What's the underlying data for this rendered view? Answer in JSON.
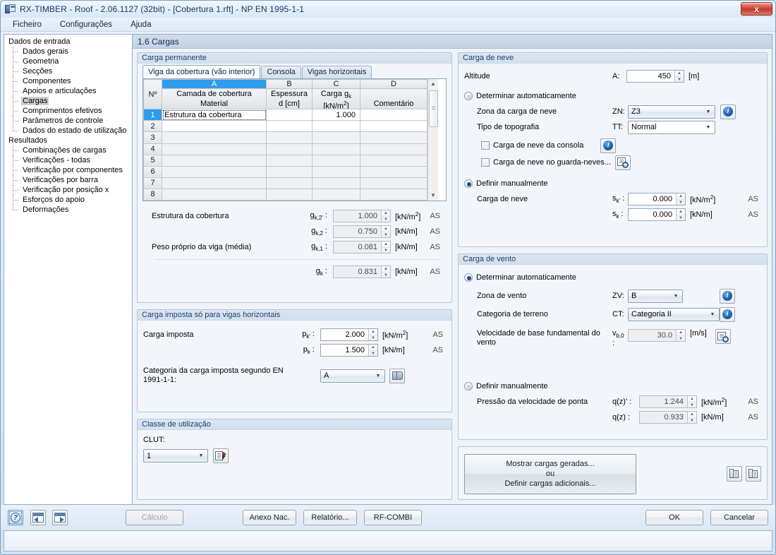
{
  "window": {
    "title": "RX-TIMBER - Roof - 2.06.1127 (32bit) - [Cobertura 1.rft] - NP EN 1995-1-1",
    "close_label": "x"
  },
  "menu": {
    "items": [
      "Ficheiro",
      "Configurações",
      "Ajuda"
    ]
  },
  "tree": {
    "groups": [
      {
        "label": "Dados de entrada",
        "items": [
          "Dados gerais",
          "Geometria",
          "Secções",
          "Componentes",
          "Apoios e articulações",
          "Cargas",
          "Comprimentos efetivos",
          "Parâmetros de controle",
          "Dados do estado de utilização"
        ],
        "selected": "Cargas"
      },
      {
        "label": "Resultados",
        "items": [
          "Combinações de cargas",
          "Verificações - todas",
          "Verificação por componentes",
          "Verificações por barra",
          "Verificação por posição x",
          "Esforços do apoio",
          "Deformações"
        ],
        "selected": ""
      }
    ]
  },
  "page": {
    "title": "1.6 Cargas"
  },
  "permanent": {
    "title": "Carga permanente",
    "tabs": [
      {
        "label": "Viga da cobertura (vão interior)",
        "active": true
      },
      {
        "label": "Consola",
        "active": false
      },
      {
        "label": "Vigas horizontais",
        "active": false
      }
    ],
    "table": {
      "row_header": "Nº",
      "columns": [
        {
          "letter": "A",
          "line1": "Camada de cobertura",
          "line2": "Material",
          "selected": true
        },
        {
          "letter": "B",
          "line1": "Espessura",
          "line2": "d [cm]",
          "selected": false
        },
        {
          "letter": "C",
          "line1": "Carga g k",
          "line2": "[kN/m 2]",
          "selected": false
        },
        {
          "letter": "D",
          "line1": "",
          "line2": "Comentário",
          "selected": false
        }
      ],
      "rows": [
        {
          "n": "1",
          "a": "Estrutura da cobertura",
          "b": "",
          "c": "1.000",
          "d": "",
          "active": true
        },
        {
          "n": "2",
          "a": "",
          "b": "",
          "c": "",
          "d": "",
          "active": false
        },
        {
          "n": "3",
          "a": "",
          "b": "",
          "c": "",
          "d": "",
          "active": false
        },
        {
          "n": "4",
          "a": "",
          "b": "",
          "c": "",
          "d": "",
          "active": false
        },
        {
          "n": "5",
          "a": "",
          "b": "",
          "c": "",
          "d": "",
          "active": false
        },
        {
          "n": "6",
          "a": "",
          "b": "",
          "c": "",
          "d": "",
          "active": false
        },
        {
          "n": "7",
          "a": "",
          "b": "",
          "c": "",
          "d": "",
          "active": false
        },
        {
          "n": "8",
          "a": "",
          "b": "",
          "c": "",
          "d": "",
          "active": false
        }
      ]
    },
    "fields": [
      {
        "label": "Estrutura da cobertura",
        "sym": "g",
        "sub": "k,2'",
        "value": "1.000",
        "unit": "[kN/m2]",
        "as": "AS",
        "readonly": true
      },
      {
        "label": "",
        "sym": "g",
        "sub": "k,2",
        "value": "0.750",
        "unit": "[kN/m]",
        "as": "AS",
        "readonly": true
      },
      {
        "label": "Peso próprio da viga (média)",
        "sym": "g",
        "sub": "k,1",
        "value": "0.081",
        "unit": "[kN/m]",
        "as": "AS",
        "readonly": true
      },
      {
        "label": "",
        "sym": "g",
        "sub": "k",
        "value": "0.831",
        "unit": "[kN/m]",
        "as": "AS",
        "readonly": true
      }
    ]
  },
  "imposed": {
    "title": "Carga imposta só para vigas horizontais",
    "rows": [
      {
        "label": "Carga imposta",
        "sym": "p",
        "sub": "k'",
        "value": "2.000",
        "unit": "[kN/m2]",
        "as": "AS"
      },
      {
        "label": "",
        "sym": "p",
        "sub": "k",
        "value": "1.500",
        "unit": "[kN/m]",
        "as": "AS"
      }
    ],
    "category_label": "Categoria da carga imposta segundo EN 1991-1-1:",
    "category_value": "A",
    "book_icon": "book-icon"
  },
  "service_class": {
    "title": "Classe de utilização",
    "label": "CLUT:",
    "value": "1",
    "icon": "document-pick-icon"
  },
  "snow": {
    "title": "Carga de neve",
    "altitude_label": "Altitude",
    "altitude_sym": "A:",
    "altitude_value": "450",
    "altitude_unit": "[m]",
    "auto_label": "Determinar automaticamente",
    "auto_selected": false,
    "zone_label": "Zona da carga de neve",
    "zone_sym": "ZN:",
    "zone_value": "Z3",
    "topo_label": "Tipo de topografia",
    "topo_sym": "TT:",
    "topo_value": "Normal",
    "check1": "Carga de neve da consola",
    "check1_checked": false,
    "check2": "Carga de neve no guarda-neves...",
    "check2_checked": false,
    "manual_label": "Definir manualmente",
    "manual_selected": true,
    "manual_rows": [
      {
        "label": "Carga de neve",
        "sym": "s",
        "sub": "k'",
        "value": "0.000",
        "unit": "[kN/m2]",
        "as": "AS"
      },
      {
        "label": "",
        "sym": "s",
        "sub": "k",
        "value": "0.000",
        "unit": "[kN/m]",
        "as": "AS"
      }
    ]
  },
  "wind": {
    "title": "Carga de vento",
    "auto_label": "Determinar automaticamente",
    "auto_selected": true,
    "zone_label": "Zona de vento",
    "zone_sym": "ZV:",
    "zone_value": "B",
    "terrain_label": "Categoria de terreno",
    "terrain_sym": "CT:",
    "terrain_value": "Categoria II",
    "vb_label": "Velocidade de base fundamental do vento",
    "vb_sym": "v",
    "vb_sub": "b,0",
    "vb_value": "30.0",
    "vb_unit": "[m/s]",
    "manual_label": "Definir manualmente",
    "manual_selected": false,
    "manual_rows": [
      {
        "label": "Pressão da velocidade de ponta",
        "sym": "q(z)'",
        "sub": "",
        "value": "1.244",
        "unit": "[kN/m2]",
        "as": "AS"
      },
      {
        "label": "",
        "sym": "q(z)",
        "sub": "",
        "value": "0.933",
        "unit": "[kN/m]",
        "as": "AS"
      }
    ]
  },
  "generated": {
    "line1": "Mostrar cargas geradas...",
    "line2": "ou",
    "line3": "Definir cargas adicionais..."
  },
  "footer": {
    "help_icon": "help-icon",
    "back_icon": "navigate-back-icon",
    "forward_icon": "navigate-forward-icon",
    "calc": "Cálculo",
    "annex": "Anexo Nac.",
    "report": "Relatório...",
    "rfcombi": "RF-COMBI",
    "ok": "OK",
    "cancel": "Cancelar"
  }
}
